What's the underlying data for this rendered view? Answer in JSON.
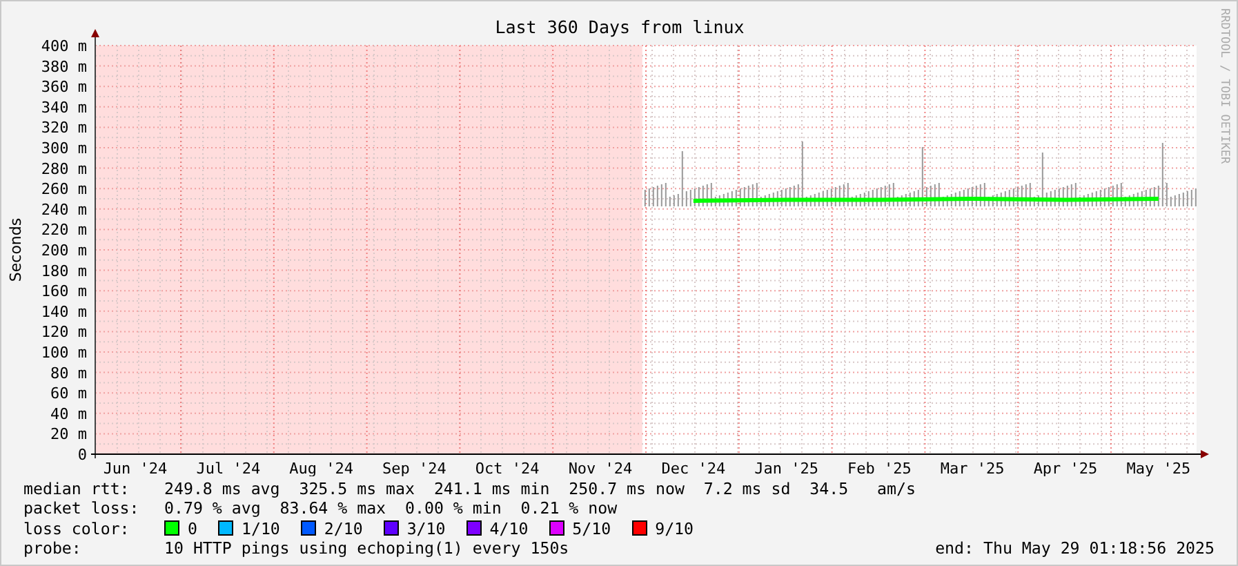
{
  "title": "Last 360 Days from linux",
  "credit": "RRDTOOL / TOBI OETIKER",
  "chart_data": {
    "type": "line",
    "ylabel": "Seconds",
    "categories": [
      "Jun '24",
      "Jul '24",
      "Aug '24",
      "Sep '24",
      "Oct '24",
      "Nov '24",
      "Dec '24",
      "Jan '25",
      "Feb '25",
      "Mar '25",
      "Apr '25",
      "May '25"
    ],
    "series": [
      {
        "name": "median rtt:",
        "color": "#00ff00",
        "values": [
          null,
          null,
          null,
          null,
          null,
          null,
          248,
          249,
          249,
          250,
          249,
          250
        ]
      }
    ],
    "ylim": [
      0,
      400
    ],
    "grid": true,
    "yticks": [
      {
        "value": 0,
        "label": "0"
      },
      {
        "value": 20,
        "label": "20 m"
      },
      {
        "value": 40,
        "label": "40 m"
      },
      {
        "value": 60,
        "label": "60 m"
      },
      {
        "value": 80,
        "label": "80 m"
      },
      {
        "value": 100,
        "label": "100 m"
      },
      {
        "value": 120,
        "label": "120 m"
      },
      {
        "value": 140,
        "label": "140 m"
      },
      {
        "value": 160,
        "label": "160 m"
      },
      {
        "value": 180,
        "label": "180 m"
      },
      {
        "value": 200,
        "label": "200 m"
      },
      {
        "value": 220,
        "label": "220 m"
      },
      {
        "value": 240,
        "label": "240 m"
      },
      {
        "value": 260,
        "label": "260 m"
      },
      {
        "value": 280,
        "label": "280 m"
      },
      {
        "value": 300,
        "label": "300 m"
      },
      {
        "value": 320,
        "label": "320 m"
      },
      {
        "value": 340,
        "label": "340 m"
      },
      {
        "value": 360,
        "label": "360 m"
      },
      {
        "value": 380,
        "label": "380 m"
      },
      {
        "value": 400,
        "label": "400 m"
      }
    ]
  },
  "stats": [
    {
      "text": "249.8 ms avg  325.5 ms max  241.1 ms min  250.7 ms now  7.2 ms sd  34.5   am/s"
    },
    {
      "label": "packet loss:",
      "text": "0.79 % avg  83.64 % max  0.00 % min  0.21 % now"
    }
  ],
  "loss_color": {
    "label": "loss color:",
    "items": [
      {
        "label": "0",
        "color": "#00ff00"
      },
      {
        "label": "1/10",
        "color": "#00b8ff"
      },
      {
        "label": "2/10",
        "color": "#0059ff"
      },
      {
        "label": "3/10",
        "color": "#5e00ff"
      },
      {
        "label": "4/10",
        "color": "#7e00ff"
      },
      {
        "label": "5/10",
        "color": "#dd00ff"
      },
      {
        "label": "9/10",
        "color": "#ff0000"
      }
    ]
  },
  "probe": {
    "label": "probe:",
    "text": "10 HTTP pings using echoping(1) every 150s"
  },
  "end": "end: Thu May 29 01:18:56 2025"
}
